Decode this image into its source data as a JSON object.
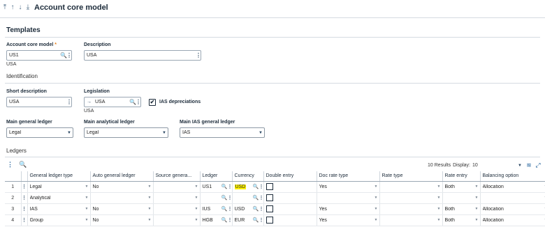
{
  "header": {
    "title": "Account core model",
    "nav_icons": [
      "first-record-icon",
      "previous-record-icon",
      "next-record-icon",
      "last-record-icon"
    ]
  },
  "templates": {
    "section_title": "Templates",
    "account_core_model": {
      "label": "Account core model",
      "required_mark": "*",
      "value": "US1",
      "sub": "USA"
    },
    "description": {
      "label": "Description",
      "value": "USA"
    }
  },
  "identification": {
    "title": "Identification",
    "short_description": {
      "label": "Short description",
      "value": "USA"
    },
    "legislation": {
      "label": "Legislation",
      "arrow": "→",
      "value": "USA",
      "sub": "USA"
    },
    "ias_depreciations": {
      "label": "IAS depreciations",
      "checked": true,
      "check_glyph": "✔"
    },
    "main_general_ledger": {
      "label": "Main general ledger",
      "value": "Legal"
    },
    "main_analytical_ledger": {
      "label": "Main analytical ledger",
      "value": "Legal"
    },
    "main_ias_general_ledger": {
      "label": "Main IAS general ledger",
      "value": "IAS"
    }
  },
  "ledgers": {
    "title": "Ledgers",
    "results": "10 Results",
    "display_label": "Display:",
    "display_value": "10",
    "columns": [
      "",
      "",
      "General ledger type",
      "Auto general ledger",
      "Source genera...",
      "Ledger",
      "Currency",
      "Double entry",
      "Doc rate type",
      "Rate type",
      "Rate entry",
      "Balancing option"
    ],
    "rows": [
      {
        "n": "1",
        "type": "Legal",
        "auto": "No",
        "source": "",
        "ledger": "US1",
        "currency": "USD",
        "currency_highlight": true,
        "double_entry": false,
        "doc_rate": "Yes",
        "rate_type": "",
        "rate_entry": "Both",
        "balancing": "Allocation"
      },
      {
        "n": "2",
        "type": "Analytical",
        "auto": "",
        "source": "",
        "ledger": "",
        "currency": "",
        "currency_highlight": false,
        "double_entry": false,
        "doc_rate": "",
        "rate_type": "",
        "rate_entry": "",
        "balancing": ""
      },
      {
        "n": "3",
        "type": "IAS",
        "auto": "No",
        "source": "",
        "ledger": "IUS",
        "currency": "USD",
        "currency_highlight": false,
        "double_entry": false,
        "doc_rate": "Yes",
        "rate_type": "",
        "rate_entry": "Both",
        "balancing": "Allocation"
      },
      {
        "n": "4",
        "type": "Group",
        "auto": "No",
        "source": "",
        "ledger": "HGB",
        "currency": "EUR",
        "currency_highlight": false,
        "double_entry": false,
        "doc_rate": "Yes",
        "rate_type": "",
        "rate_entry": "Both",
        "balancing": "Allocation"
      }
    ]
  },
  "colors": {
    "accent": "#1f5f9a",
    "highlight": "#fff200",
    "required": "#e8801b"
  }
}
